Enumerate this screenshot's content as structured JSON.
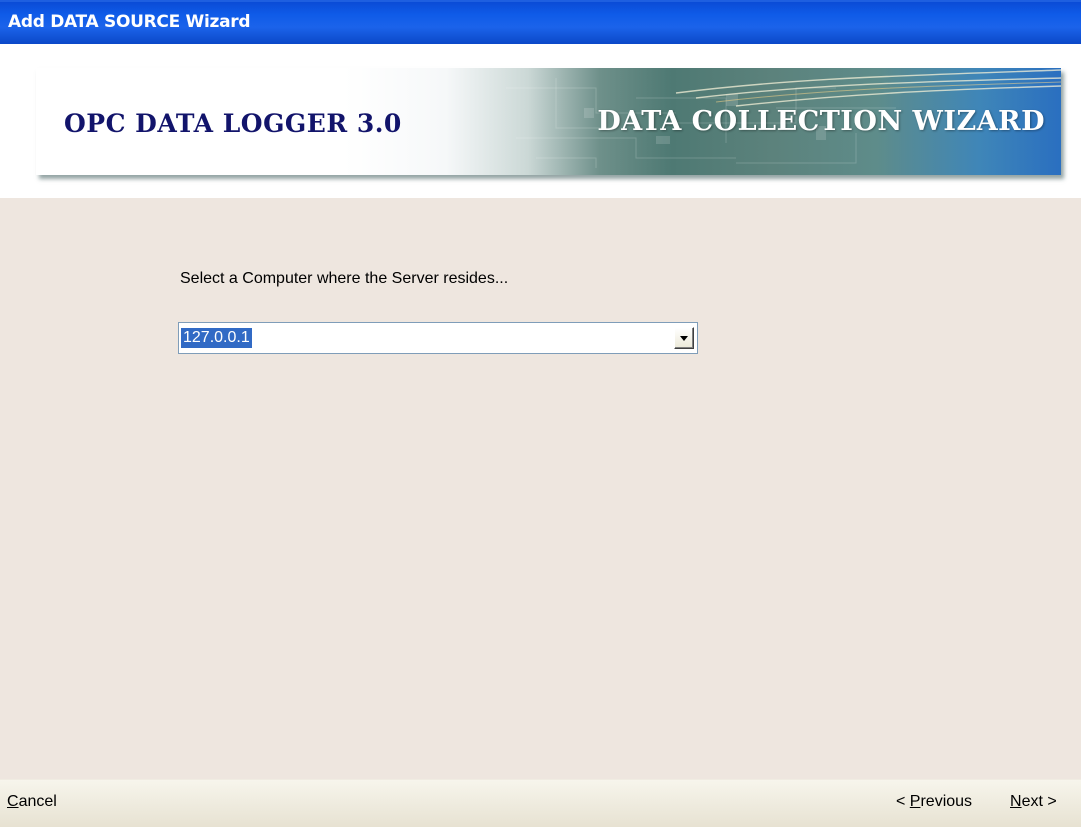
{
  "window": {
    "title": "Add DATA SOURCE Wizard"
  },
  "banner": {
    "product_name": "OPC DATA LOGGER 3.0",
    "wizard_name": "DATA COLLECTION WIZARD"
  },
  "step": {
    "prompt": "Select a Computer where the Server resides...",
    "computer_select": {
      "value": "127.0.0.1"
    }
  },
  "footer": {
    "cancel": {
      "accel": "C",
      "rest": "ancel"
    },
    "previous": {
      "prefix": "< ",
      "accel": "P",
      "rest": "revious"
    },
    "next": {
      "accel": "N",
      "rest": "ext >"
    }
  },
  "colors": {
    "title_bar": "#0F5BE8",
    "selection_highlight": "#316AC5",
    "content_background": "#EEE6DF",
    "banner_text": "#12146B"
  },
  "icons": {
    "dropdown": "chevron-down-icon"
  }
}
